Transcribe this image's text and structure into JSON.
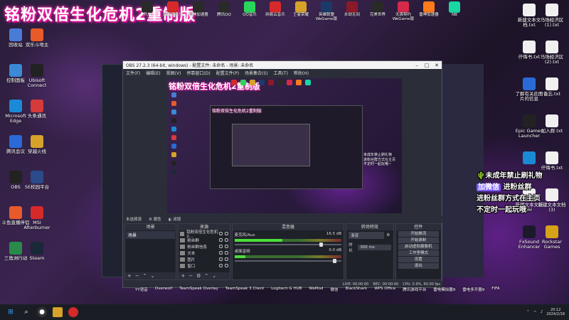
{
  "banner": {
    "title": "铭粉双倍生化危机2重制版"
  },
  "desktop_left": [
    {
      "label": "回收站",
      "color": "#4a7bd6"
    },
    {
      "label": "双乐斗地主",
      "color": "#e85a2a"
    },
    {
      "label": "控制面板",
      "color": "#3a8ad6"
    },
    {
      "label": "Ubisoft Connect",
      "color": "#222222"
    },
    {
      "label": "Microsoft Edge",
      "color": "#1a8ad6"
    },
    {
      "label": "头条通讯",
      "color": "#d63a3a"
    },
    {
      "label": "腾讯会议",
      "color": "#2a6ad6"
    },
    {
      "label": "穿越火线",
      "color": "#d6a22a"
    },
    {
      "label": "OBS",
      "color": "#222222"
    },
    {
      "label": "SE校园平台",
      "color": "#2a4a8a"
    },
    {
      "label": "斗鱼直播伴侣",
      "color": "#e85a2a"
    },
    {
      "label": "MSI Afterburner",
      "color": "#d62a2a"
    },
    {
      "label": "三角洲行动",
      "color": "#2a8a4a"
    },
    {
      "label": "Steam",
      "color": "#1b2838"
    }
  ],
  "desktop_top": [
    {
      "label": "开户",
      "color": "#2a2a2a"
    },
    {
      "label": "网易云音乐",
      "color": "#d62a2a"
    },
    {
      "label": "雷神加速器",
      "color": "#2a2a2a"
    },
    {
      "label": "腾讯QQ",
      "color": "#2a2a2a"
    },
    {
      "label": "QQ音乐",
      "color": "#2ad65a"
    },
    {
      "label": "网易云音乐",
      "color": "#d62a2a"
    },
    {
      "label": "王者荣耀",
      "color": "#d6a22a"
    },
    {
      "label": "英雄联盟 WeGame版",
      "color": "#1a3a6a"
    },
    {
      "label": "永劫无间",
      "color": "#8a1a2a"
    },
    {
      "label": "完美世界",
      "color": "#2a2a2a"
    },
    {
      "label": "无畏契约 WeGame版",
      "color": "#d62a4a"
    },
    {
      "label": "雷神加速器",
      "color": "#ff7a1a"
    },
    {
      "label": "NB",
      "color": "#1ad6a2"
    }
  ],
  "desktop_right": [
    {
      "label": "新建文本文档.txt",
      "color": "#f0f0f0"
    },
    {
      "label": "马场经济区 (1).txt",
      "color": "#f0f0f0"
    },
    {
      "label": "仟悔书.txt",
      "color": "#f0f0f0"
    },
    {
      "label": "马场经济区 (2).txt",
      "color": "#f0f0f0"
    },
    {
      "label": "了解有关此图片的信息",
      "color": "#2a6ad6"
    },
    {
      "label": "备忘.txt",
      "color": "#f0f0f0"
    },
    {
      "label": "Epic Games Launcher",
      "color": "#222222"
    },
    {
      "label": "加入群.txt",
      "color": "#f0f0f0"
    },
    {
      "label": "",
      "color": "#1a8ad6"
    },
    {
      "label": "仟悔书.txt",
      "color": "#f0f0f0"
    },
    {
      "label": "新建文本文档 (2)",
      "color": "#f0f0f0"
    },
    {
      "label": "新建文本文档 (3)",
      "color": "#f0f0f0"
    },
    {
      "label": "FxSound Enhancer",
      "color": "#1a1a2a"
    },
    {
      "label": "Rockstar Games",
      "color": "#d6a21a"
    }
  ],
  "obs": {
    "title": "OBS 27.2.3 (64-bit, windows) - 配置文件: 未命名 - 场景: 未命名",
    "menu": [
      "文件(F)",
      "编辑(E)",
      "视图(V)",
      "停靠窗口(D)",
      "配置文件(P)",
      "场景集合(S)",
      "工具(T)",
      "帮助(H)"
    ],
    "preview_title": "铭粉双倍生化危机2重制版",
    "no_source": "未选择源",
    "props": "属性",
    "filters": "滤镜",
    "docks": {
      "scenes": "场景",
      "sources": "来源",
      "mixer": "混音器",
      "transitions": "转场特效",
      "controls": "控件"
    },
    "scene_item": "场景",
    "sources": [
      "铭粉双倍生化危机2...",
      "粉丝群",
      "粉丝群信息",
      "文本",
      "图片",
      "窗口"
    ],
    "mixer": [
      {
        "name": "麦克风/Aux",
        "db": "16.5 dB",
        "level": 0.45,
        "vol": 0.82
      },
      {
        "name": "桌面音频",
        "db": "0.0 dB",
        "level": 0.1,
        "vol": 0.95
      }
    ],
    "transition": {
      "type": "渐变",
      "duration_label": "时长",
      "duration": "300 ms"
    },
    "controls": [
      "开始推流",
      "开始录制",
      "启动虚拟摄像机",
      "工作室模式",
      "设置",
      "退出"
    ],
    "status": [
      "LIVE: 00:00:00",
      "REC: 00:00:00",
      "CPU: 0.9%, 60.00 fps"
    ]
  },
  "sticker": {
    "line1": "未成年禁止刷礼物",
    "line2a": "加微信",
    "line2b": "进粉丝群",
    "line3": "进粉丝群方式在主页",
    "line4": "不定时一起玩哦~"
  },
  "bottom_labels": [
    "YY语音",
    "Overwolf",
    "TeamSpeak Overlay",
    "TeamSpeak 3 Client",
    "Logitech G HUB",
    "WeMod",
    "微信",
    "BlackShark",
    "WPS Office",
    "腾讯游戏平台",
    "雷电模拟器9",
    "雷电多开器9",
    "FIFA"
  ],
  "taskbar": {
    "time": "20:12",
    "date": "2024/2/18"
  }
}
